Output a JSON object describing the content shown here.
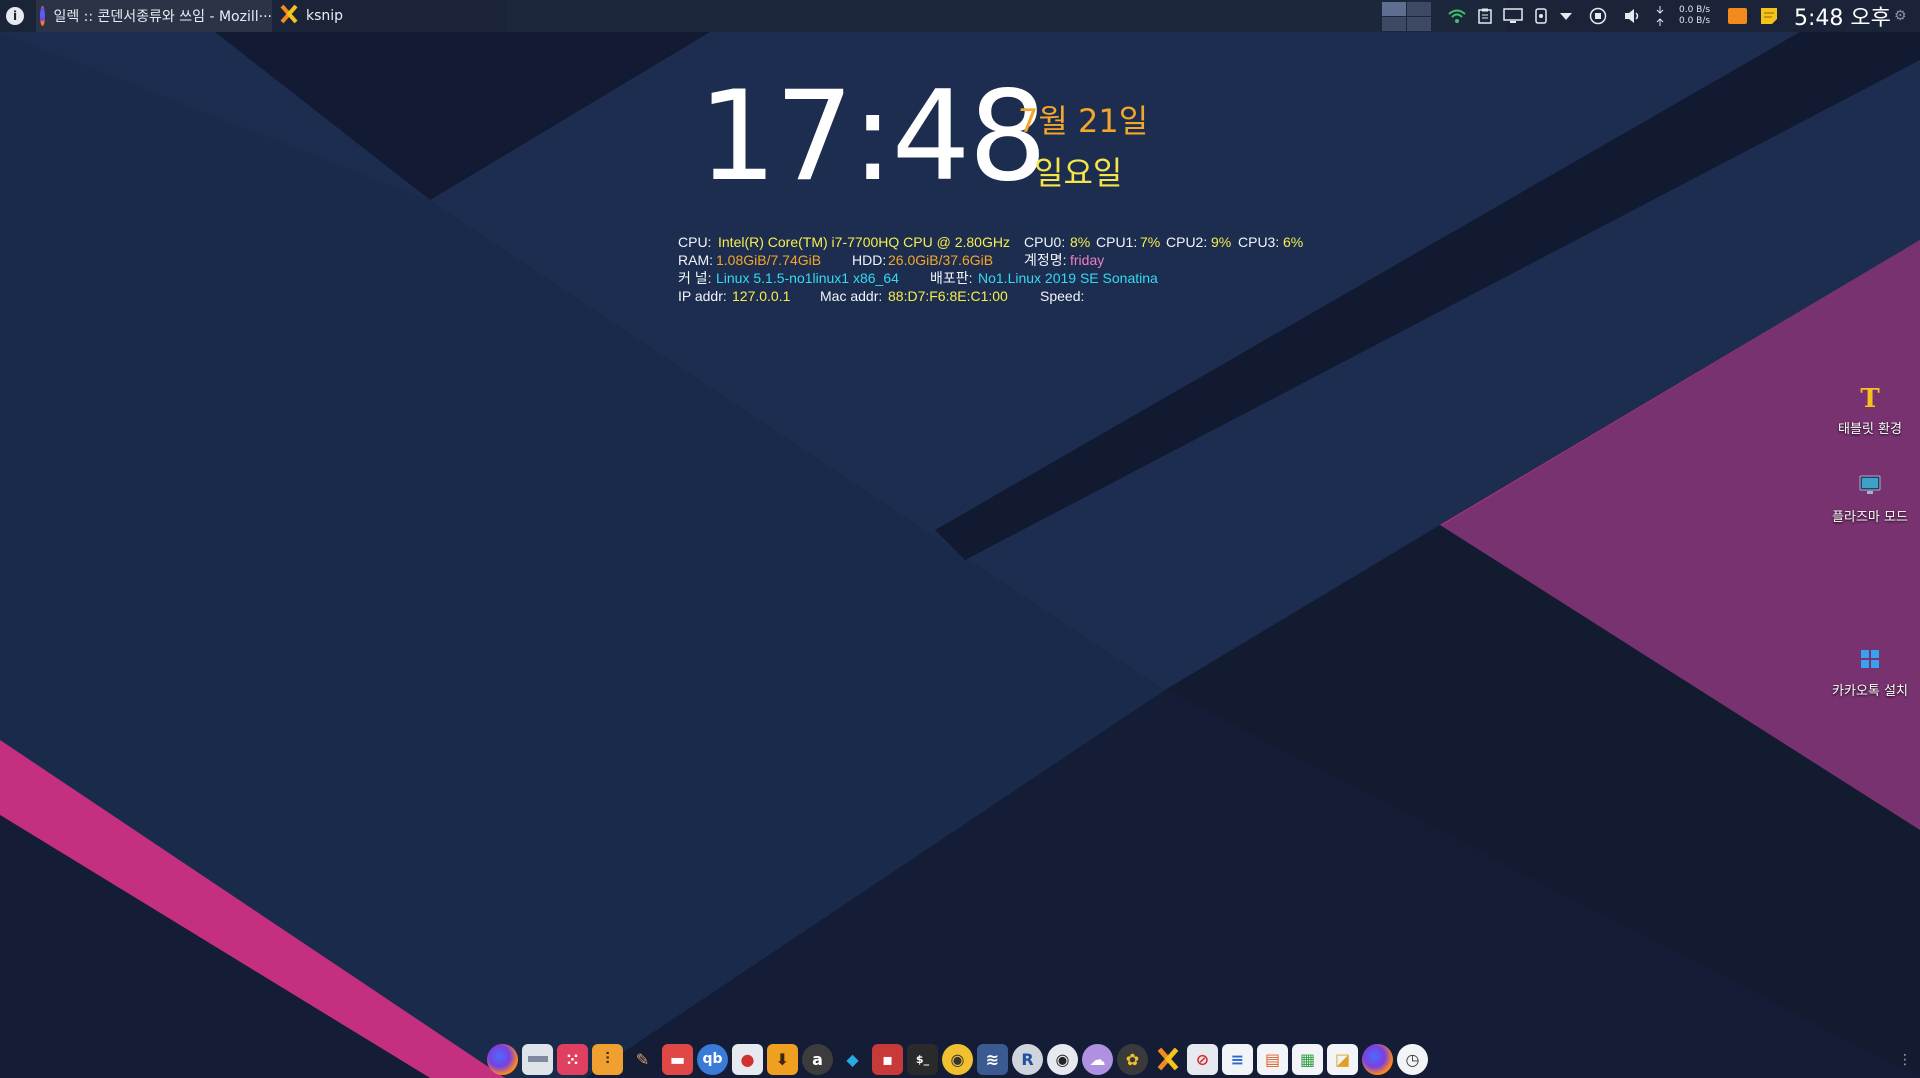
{
  "taskbar": {
    "tasks": [
      {
        "title": "일렉 :: 콘덴서종류와 쓰임 - Mozill···",
        "icon": "firefox-icon"
      },
      {
        "title": "ksnip",
        "icon": "ksnip-icon"
      }
    ],
    "net_down": "0.0 B/s",
    "net_up": "0.0 B/s",
    "clock": "5:48 오후"
  },
  "conky": {
    "time": "17:48",
    "date": "7월 21일",
    "weekday": "일요일",
    "cpu_label": "CPU:",
    "cpu_model": "Intel(R) Core(TM) i7-7700HQ CPU @ 2.80GHz",
    "cpu0_label": "CPU0:",
    "cpu0": "8%",
    "cpu1_label": "CPU1:",
    "cpu1": "7%",
    "cpu2_label": "CPU2:",
    "cpu2": "9%",
    "cpu3_label": "CPU3:",
    "cpu3": "6%",
    "ram_label": "RAM:",
    "ram": "1.08GiB/7.74GiB",
    "hdd_label": "HDD:",
    "hdd": "26.0GiB/37.6GiB",
    "account_label": "계정명:",
    "account": "friday",
    "kernel_label": "커 널:",
    "kernel": "Linux 5.1.5-no1linux1 x86_64",
    "distro_label": "배포판:",
    "distro": "No1.Linux 2019 SE Sonatina",
    "ip_label": "IP addr:",
    "ip": "127.0.0.1",
    "mac_label": "Mac addr:",
    "mac": "88:D7:F6:8E:C1:00",
    "speed_label": "Speed:"
  },
  "desktop_icons": [
    {
      "label": "태블릿 환경",
      "icon": "tablet-mode-icon"
    },
    {
      "label": "플라즈마 모드",
      "icon": "plasma-mode-icon"
    },
    {
      "label": "카카오톡 설치",
      "icon": "windows-installer-icon"
    }
  ],
  "dock_icons": [
    "firefox-icon",
    "files-icon",
    "dice-icon",
    "mixer-icon",
    "brush-icon",
    "screenshot-icon",
    "qbittorrent-icon",
    "document-viewer-icon",
    "download-icon",
    "amazon-icon",
    "kodi-icon",
    "video-recorder-icon",
    "terminal-icon",
    "disc-icon",
    "audio-editor-icon",
    "r-icon",
    "eye-icon",
    "weather-icon",
    "palette-icon",
    "ksnip-icon",
    "pdf-icon",
    "writer-icon",
    "impress-icon",
    "calc-icon",
    "draw-icon",
    "firefox-icon",
    "clock-icon"
  ],
  "colors": {
    "panel": "#1a2338",
    "navy": "#1f3358",
    "dark_navy": "#141d35",
    "magenta": "#c4307f",
    "yellow": "#f7ee4d",
    "orange": "#f4a62a",
    "cyan": "#36d9f0"
  }
}
